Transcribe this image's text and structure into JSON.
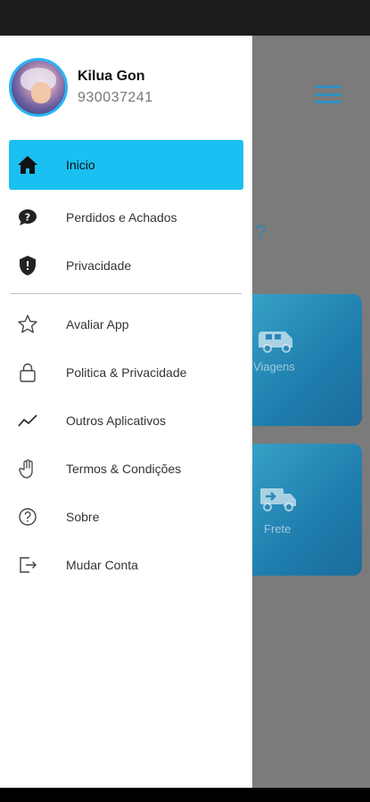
{
  "background": {
    "question_mark": "?",
    "cards": [
      {
        "label": "Viagens",
        "icon": "van-icon"
      },
      {
        "label": "Frete",
        "icon": "delivery-truck-icon"
      }
    ]
  },
  "drawer": {
    "profile": {
      "name": "Kilua Gon",
      "phone": "930037241"
    },
    "primary_items": [
      {
        "label": "Inicio",
        "icon": "home-icon",
        "active": true
      },
      {
        "label": "Perdidos e Achados",
        "icon": "question-bubble-icon"
      },
      {
        "label": "Privacidade",
        "icon": "shield-icon"
      }
    ],
    "secondary_items": [
      {
        "label": "Avaliar App",
        "icon": "star-icon"
      },
      {
        "label": "Politica & Privacidade",
        "icon": "lock-icon"
      },
      {
        "label": "Outros Aplicativos",
        "icon": "trend-line-icon"
      },
      {
        "label": "Termos & Condições",
        "icon": "hand-icon"
      },
      {
        "label": "Sobre",
        "icon": "help-circle-icon"
      },
      {
        "label": "Mudar Conta",
        "icon": "logout-icon"
      }
    ]
  },
  "colors": {
    "active_item": "#1bc0f2",
    "avatar_border": "#29b6f6",
    "card_gradient_start": "#3aa6c9",
    "card_gradient_end": "#1b6d9c",
    "hamburger": "#2f8fc1"
  }
}
